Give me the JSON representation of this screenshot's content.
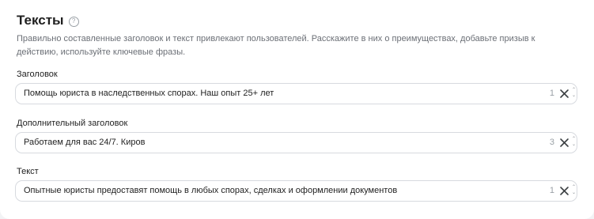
{
  "section": {
    "title": "Тексты",
    "help_icon": "question-circle-icon",
    "description": "Правильно составленные заголовок и текст привлекают пользователей. Расскажите в них о преимуществах, добавьте призыв к действию, используйте ключевые фразы."
  },
  "fields": [
    {
      "label": "Заголовок",
      "value": "Помощь юриста в наследственных спорах. Наш опыт 25+ лет",
      "count": "1"
    },
    {
      "label": "Дополнительный заголовок",
      "value": "Работаем для вас 24/7. Киров",
      "count": "3"
    },
    {
      "label": "Текст",
      "value": "Опытные юристы предоставят помощь в любых спорах, сделках и оформлении документов",
      "count": "1"
    }
  ],
  "icons": {
    "clear": "close-icon",
    "resize": "resize-grip-icon"
  }
}
